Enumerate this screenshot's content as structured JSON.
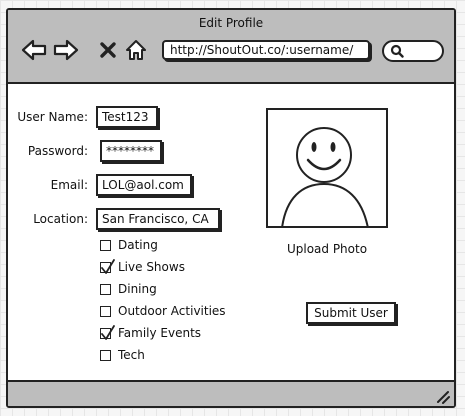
{
  "window": {
    "title": "Edit Profile",
    "url": "http://ShoutOut.co/:username/",
    "icons": {
      "back": "left-arrow-icon",
      "forward": "right-arrow-icon",
      "stop": "close-icon",
      "home": "home-icon",
      "search": "search-icon",
      "resize": "resize-grip-icon"
    }
  },
  "form": {
    "username": {
      "label": "User Name:",
      "value": "Test123"
    },
    "password": {
      "label": "Password:",
      "value": "********"
    },
    "email": {
      "label": "Email:",
      "value": "LOL@aol.com"
    },
    "location": {
      "label": "Location:",
      "value": "San Francisco, CA"
    },
    "interests": [
      {
        "label": "Dating",
        "checked": false
      },
      {
        "label": "Live Shows",
        "checked": true
      },
      {
        "label": "Dining",
        "checked": false
      },
      {
        "label": "Outdoor Activities",
        "checked": false
      },
      {
        "label": "Family Events",
        "checked": true
      },
      {
        "label": "Tech",
        "checked": false
      }
    ]
  },
  "photo": {
    "upload_label": "Upload Photo",
    "icon": "smiley-avatar-icon"
  },
  "actions": {
    "submit_label": "Submit User"
  }
}
